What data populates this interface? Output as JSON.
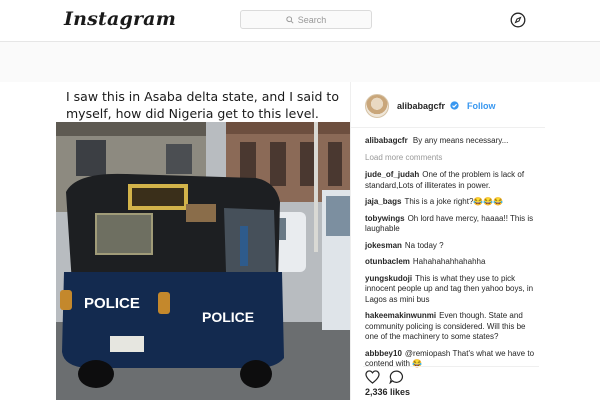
{
  "header": {
    "logo": "Instagram",
    "search_placeholder": "Search"
  },
  "post": {
    "caption_image_text": "I saw this in Asaba delta state, and I said to myself, how did Nigeria get to this level.",
    "photo_text": {
      "police_left": "POLICE",
      "police_right": "POLICE"
    },
    "author": "alibabagcfr",
    "follow_label": "Follow",
    "author_caption": {
      "user": "alibabagcfr",
      "text": "By any means necessary..."
    },
    "load_more": "Load more comments",
    "comments": [
      {
        "user": "jude_of_judah",
        "text": "One of the problem is lack of standard,Lots of illiterates in power."
      },
      {
        "user": "jaja_bags",
        "text": "This is a joke right?😂😂😂"
      },
      {
        "user": "tobywings",
        "text": "Oh lord have mercy, haaaa!! This is laughable"
      },
      {
        "user": "jokesman",
        "text": "Na today ?"
      },
      {
        "user": "otunbaclem",
        "text": "Hahahahahhahahha"
      },
      {
        "user": "yungskudoji",
        "text": "This is what they use to pick innocent people up and tag then yahoo boys, in Lagos as mini bus"
      },
      {
        "user": "hakeemakinwunmi",
        "text": "Even though. State and community policing is considered. Will this be one of the machinery to some states?"
      },
      {
        "user": "abbbey10",
        "text": "@remiopash That's what we have to contend with 😂"
      }
    ],
    "likes": "2,336 likes"
  },
  "colors": {
    "link_blue": "#3897f0",
    "text_dark": "#262626",
    "muted": "#999999",
    "border": "#efefef"
  }
}
